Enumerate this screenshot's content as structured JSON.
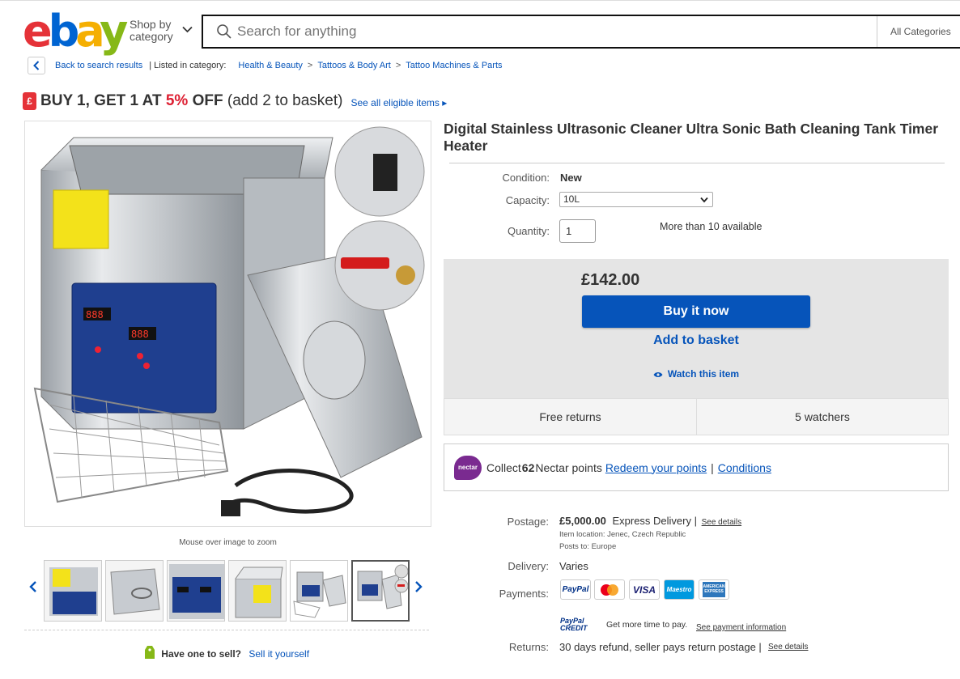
{
  "header": {
    "logo_letters": [
      "e",
      "b",
      "a",
      "y"
    ],
    "logo_colors": [
      "#e53238",
      "#0064d2",
      "#f5af02",
      "#86b817"
    ],
    "shop_by_category": "Shop by category",
    "search_placeholder": "Search for anything",
    "category_select": "All Categories"
  },
  "breadcrumb": {
    "back": "Back to search results",
    "listed_in": "| Listed in category:",
    "items": [
      "Health & Beauty",
      "Tattoos & Body Art",
      "Tattoo Machines & Parts"
    ]
  },
  "promo": {
    "tag": "£",
    "part1": "BUY 1, GET 1 AT ",
    "percent": "5%",
    "part2": " OFF",
    "part3": " (add 2 to basket)",
    "see_all": "See all eligible items ▸"
  },
  "gallery": {
    "zoom_note": "Mouse over image to zoom",
    "thumbnail_count": 6,
    "selected_thumbnail": 6
  },
  "sell": {
    "question": "Have one to sell?",
    "link": "Sell it yourself"
  },
  "item": {
    "title": "Digital Stainless Ultrasonic Cleaner Ultra Sonic Bath Cleaning Tank Timer Heater",
    "condition_label": "Condition:",
    "condition": "New",
    "capacity_label": "Capacity:",
    "capacity": "10L",
    "quantity_label": "Quantity:",
    "quantity": "1",
    "available": "More than 10 available",
    "price": "£142.00",
    "buy_now": "Buy it now",
    "add_to_basket": "Add to basket",
    "watch": "Watch this item",
    "free_returns": "Free returns",
    "watchers": "5 watchers"
  },
  "nectar": {
    "badge": "nectar",
    "collect": "Collect ",
    "points": "62",
    "points_text": " Nectar points",
    "redeem": "Redeem your points",
    "sep": "|",
    "conditions": "Conditions"
  },
  "shipping": {
    "postage_label": "Postage:",
    "postage_price": "£5,000.00",
    "postage_service": "Express Delivery |",
    "see_details": "See details",
    "item_location": "Item location:  Jenec, Czech Republic",
    "posts_to": "Posts to:  Europe",
    "delivery_label": "Delivery:",
    "delivery": "Varies",
    "payments_label": "Payments:",
    "payment_methods": [
      "PayPal",
      "mastercard",
      "VISA",
      "Maestro",
      "AMERICAN EXPRESS"
    ],
    "paypal_credit": "PayPal CREDIT",
    "more_time": "Get more time to pay.",
    "see_payment": "See payment information",
    "returns_label": "Returns:",
    "returns": "30 days refund, seller pays return postage |",
    "returns_details": "See details"
  }
}
